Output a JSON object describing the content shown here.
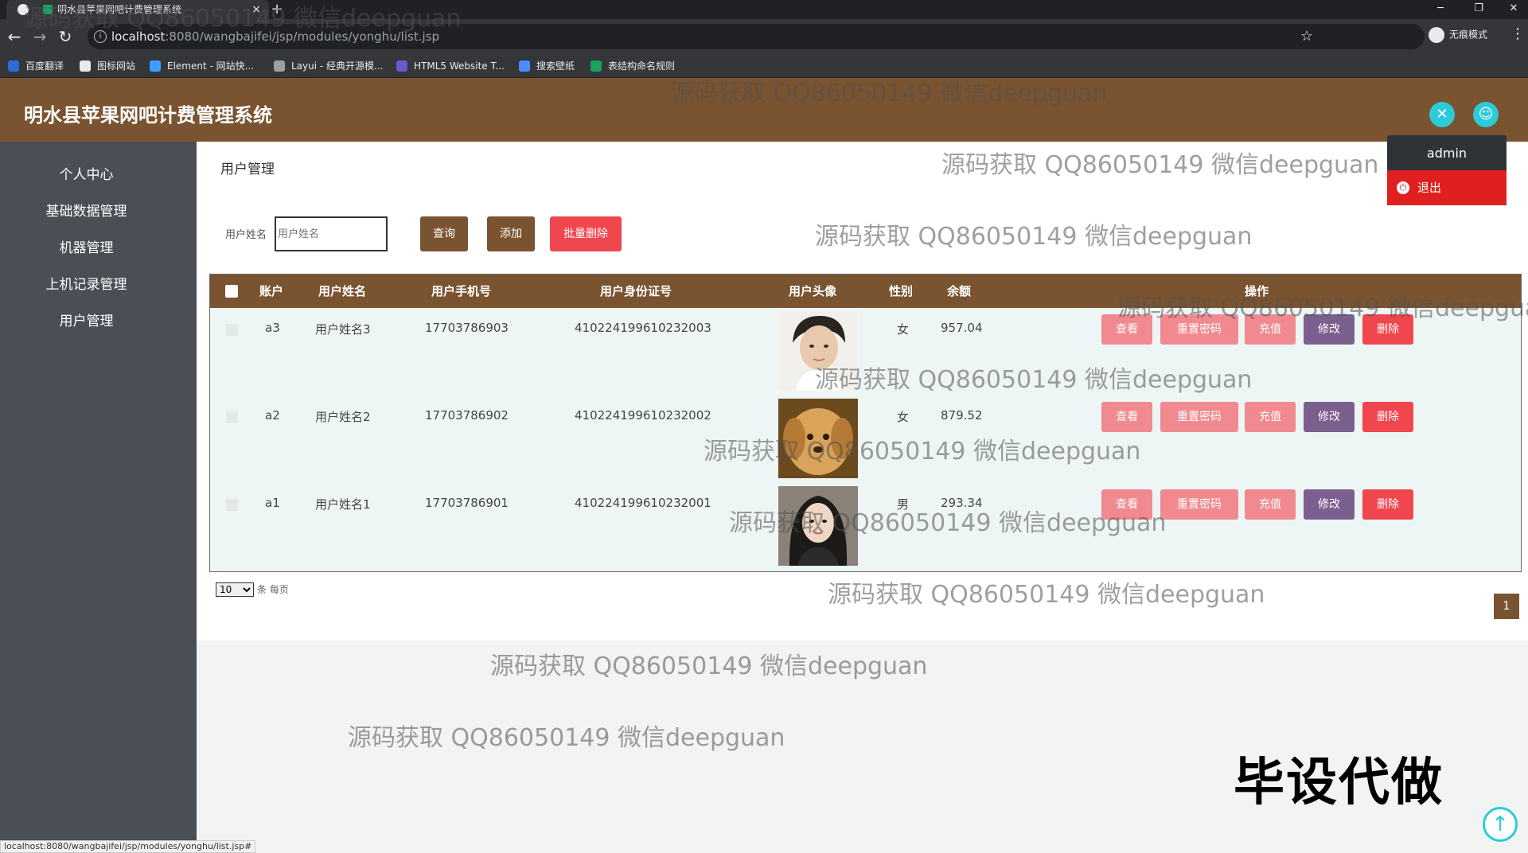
{
  "browser": {
    "tab_title": "明水县苹果网吧计费管理系统",
    "tab_close": "×",
    "new_tab": "+",
    "url_host": "localhost",
    "url_path": ":8080/wangbajifei/jsp/modules/yonghu/list.jsp",
    "incognito": "无痕模式",
    "bookmarks": [
      {
        "label": "百度翻译",
        "color": "#2e6bd8"
      },
      {
        "label": "图标网站",
        "color": "#e8eaed"
      },
      {
        "label": "Element - 网站快...",
        "color": "#409eff"
      },
      {
        "label": "Layui - 经典开源模...",
        "color": "#9aa0a6"
      },
      {
        "label": "HTML5 Website T...",
        "color": "#6a5acd"
      },
      {
        "label": "搜索壁纸",
        "color": "#4e8cff"
      },
      {
        "label": "表结构命名规则",
        "color": "#1aa260"
      }
    ],
    "status_url": "localhost:8080/wangbajifei/jsp/modules/yonghu/list.jsp#"
  },
  "app": {
    "title": "明水县苹果网吧计费管理系统",
    "brand_color": "#7a5330",
    "user_menu": {
      "name": "admin",
      "logout": "退出"
    }
  },
  "sidebar": {
    "items": [
      {
        "label": "个人中心"
      },
      {
        "label": "基础数据管理"
      },
      {
        "label": "机器管理"
      },
      {
        "label": "上机记录管理"
      },
      {
        "label": "用户管理"
      }
    ]
  },
  "main": {
    "breadcrumb": "用户管理",
    "search": {
      "label": "用户姓名",
      "placeholder": "用户姓名"
    },
    "buttons": {
      "query": "查询",
      "add": "添加",
      "batch_delete": "批量删除"
    },
    "table": {
      "headers": {
        "account": "账户",
        "name": "用户姓名",
        "phone": "用户手机号",
        "id_card": "用户身份证号",
        "avatar": "用户头像",
        "gender": "性别",
        "balance": "余额",
        "actions": "操作"
      },
      "rows": [
        {
          "account": "a3",
          "name": "用户姓名3",
          "phone": "17703786903",
          "id_card": "410224199610232003",
          "avatar": "young man portrait",
          "gender": "女",
          "balance": "957.04"
        },
        {
          "account": "a2",
          "name": "用户姓名2",
          "phone": "17703786902",
          "id_card": "410224199610232002",
          "avatar": "golden puppy",
          "gender": "女",
          "balance": "879.52"
        },
        {
          "account": "a1",
          "name": "用户姓名1",
          "phone": "17703786901",
          "id_card": "410224199610232001",
          "avatar": "young woman portrait",
          "gender": "男",
          "balance": "293.34"
        }
      ],
      "row_actions": {
        "view": "查看",
        "reset_password": "重置密码",
        "recharge": "充值",
        "edit": "修改",
        "delete": "删除"
      }
    },
    "page_size": {
      "value": "10",
      "suffix": "条 每页"
    },
    "pagination": {
      "current": "1"
    }
  },
  "watermarks": [
    "源码获取 QQ86050149 微信deepguan",
    "毕设代做"
  ]
}
